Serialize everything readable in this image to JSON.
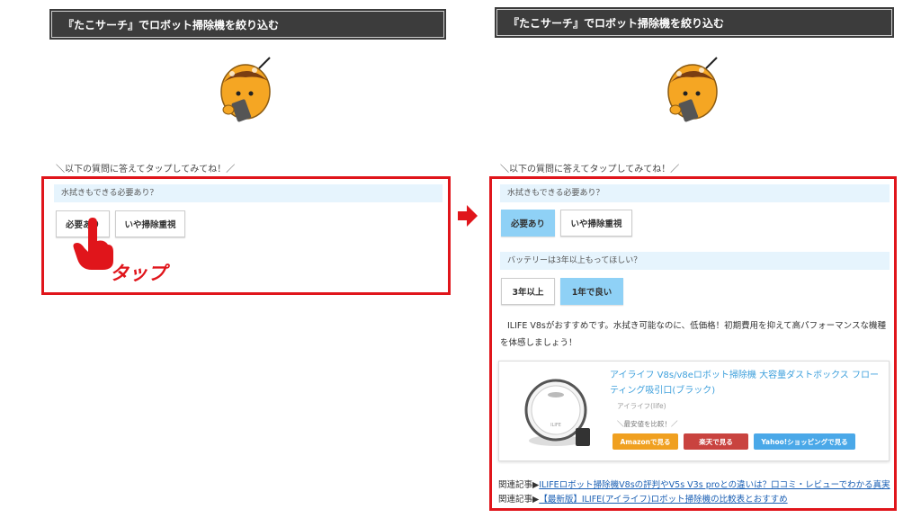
{
  "left": {
    "header_title": "『たこサーチ』でロボット掃除機を絞り込む",
    "prompt": "＼以下の質問に答えてタップしてみてね！／",
    "question1": "水拭きもできる必要あり？",
    "option_yes": "必要あり",
    "option_no": "いや掃除重視",
    "tap_label": "タップ"
  },
  "right": {
    "header_title": "『たこサーチ』でロボット掃除機を絞り込む",
    "prompt": "＼以下の質問に答えてタップしてみてね！／",
    "question1": "水拭きもできる必要あり？",
    "option_yes": "必要あり",
    "option_no": "いや掃除重視",
    "question2": "バッテリーは3年以上もってほしい？",
    "option_3y": "3年以上",
    "option_1y": "1年で良い",
    "result_text": "ILIFE V8sがおすすめです。水拭き可能なのに、低価格！初期費用を抑えて高パフォーマンスな機種を体感しましょう！",
    "product": {
      "title": "アイライフ V8s/v8eロボット掃除機 大容量ダストボックス フローティング吸引口(ブラック)",
      "brand": "アイライフ(Iife)",
      "compare_label": "＼最安値を比較！／",
      "robot_label": "ILIFE",
      "buttons": {
        "amazon": "Amazonで見る",
        "rakuten": "楽天で見る",
        "yahoo": "Yahoo!ショッピングで見る"
      }
    },
    "related": [
      {
        "prefix": "関連記事▶",
        "link": "ILIFEロボット掃除機V8sの評判やV5s V3s proとの違いは？口コミ・レビューでわかる真実"
      },
      {
        "prefix": "関連記事▶",
        "link": "【最新版】ILIFE(アイライフ)ロボット掃除機の比較表とおすすめ"
      }
    ]
  },
  "colors": {
    "header_bg": "#3c3c3c",
    "highlight_red": "#e0151b",
    "question_bg": "#e6f4fd",
    "selected_option": "#8fd1f6",
    "link_blue": "#3ea0dc",
    "amazon": "#f0a020",
    "rakuten": "#c9433f",
    "yahoo": "#4aa8e8"
  },
  "icons": [
    "takoyaki-mascot-icon",
    "tap-hand-icon",
    "right-arrow-icon",
    "robot-vacuum-image"
  ]
}
